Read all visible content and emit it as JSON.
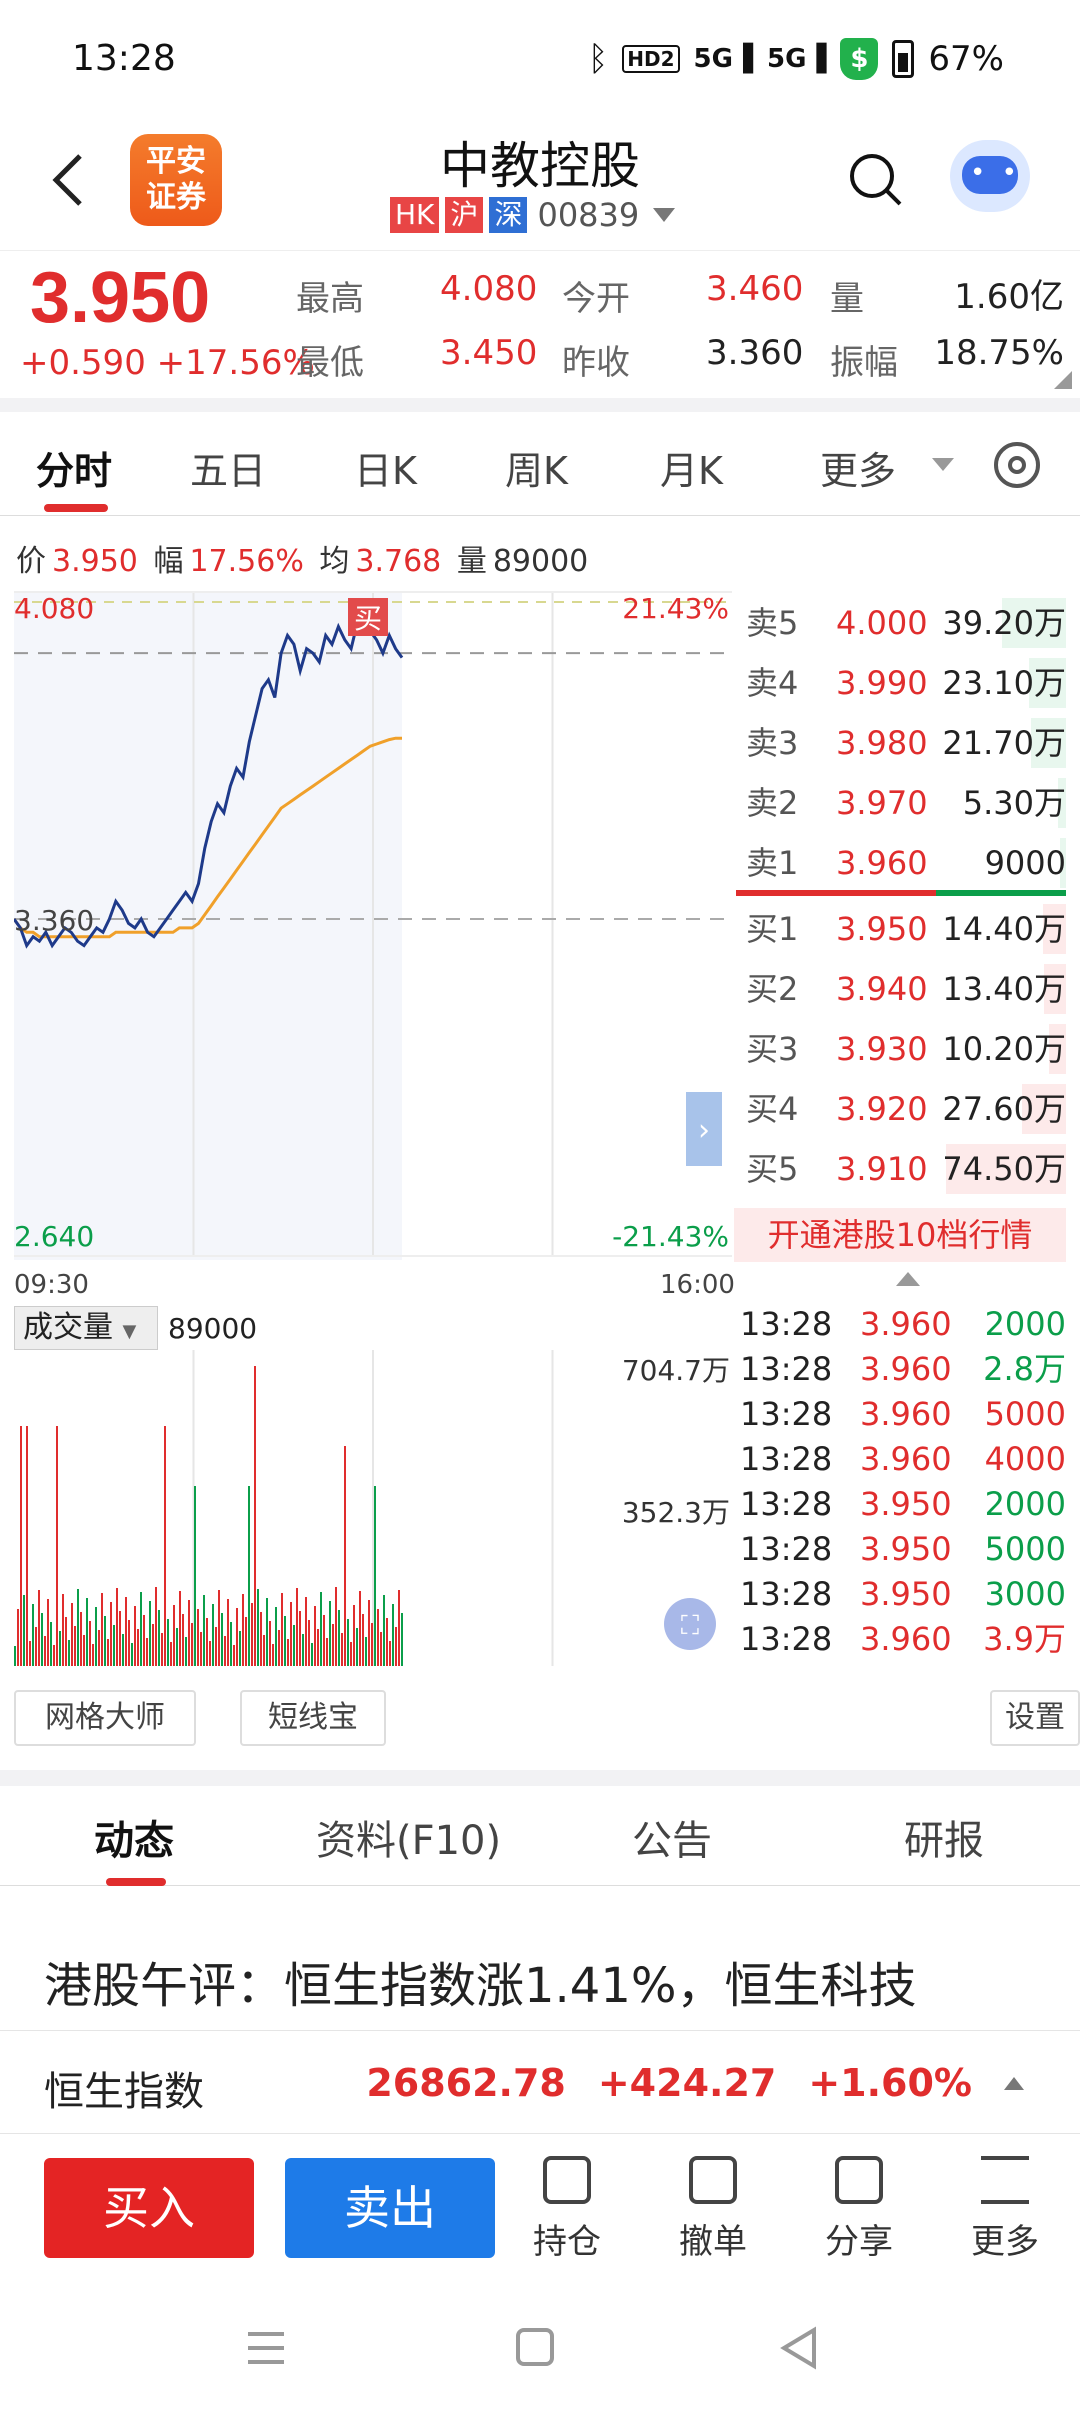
{
  "status_bar": {
    "time": "13:28",
    "hd_label": "HD2",
    "signal1": "5G",
    "signal2": "5G",
    "battery": "67%"
  },
  "header": {
    "logo_text_1": "平安",
    "logo_text_2": "证券",
    "title": "中教控股",
    "tags": [
      "HK",
      "沪",
      "深"
    ],
    "code": "00839"
  },
  "quote": {
    "price": "3.950",
    "change": "+0.590",
    "change_pct": "+17.56%",
    "high_label": "最高",
    "high": "4.080",
    "low_label": "最低",
    "low": "3.450",
    "open_label": "今开",
    "open": "3.460",
    "prev_label": "昨收",
    "prev": "3.360",
    "vol_label": "量",
    "vol": "1.60亿",
    "amp_label": "振幅",
    "amp": "18.75%"
  },
  "tabs": [
    "分时",
    "五日",
    "日K",
    "周K",
    "月K",
    "更多"
  ],
  "info_line": {
    "price_label": "价",
    "price": "3.950",
    "pct_label": "幅",
    "pct": "17.56%",
    "avg_label": "均",
    "avg": "3.768",
    "vol_label": "量",
    "vol": "89000"
  },
  "chart_data": {
    "type": "line",
    "y_max_label": "4.080",
    "y_mid_label": "3.360",
    "y_min_label": "2.640",
    "pct_max_label": "21.43%",
    "pct_min_label": "-21.43%",
    "x_start": "09:30",
    "x_end": "16:00",
    "ylim": [
      2.64,
      4.08
    ],
    "prev_close": 3.36,
    "buy_marker": "买",
    "price_series": [
      3.36,
      3.34,
      3.3,
      3.32,
      3.31,
      3.33,
      3.3,
      3.32,
      3.34,
      3.33,
      3.31,
      3.3,
      3.32,
      3.34,
      3.33,
      3.36,
      3.4,
      3.38,
      3.35,
      3.34,
      3.36,
      3.33,
      3.32,
      3.34,
      3.36,
      3.38,
      3.4,
      3.42,
      3.4,
      3.44,
      3.52,
      3.58,
      3.62,
      3.6,
      3.66,
      3.7,
      3.68,
      3.76,
      3.82,
      3.88,
      3.9,
      3.86,
      3.96,
      4.0,
      3.98,
      3.92,
      3.97,
      3.96,
      3.94,
      4.0,
      3.98,
      4.02,
      3.99,
      3.97,
      4.03,
      4.08,
      4.01,
      3.99,
      3.96,
      4.0,
      3.97,
      3.95
    ],
    "avg_series": [
      3.36,
      3.34,
      3.33,
      3.33,
      3.32,
      3.32,
      3.32,
      3.32,
      3.32,
      3.32,
      3.32,
      3.32,
      3.32,
      3.32,
      3.32,
      3.32,
      3.33,
      3.33,
      3.33,
      3.33,
      3.33,
      3.33,
      3.33,
      3.33,
      3.33,
      3.33,
      3.34,
      3.34,
      3.34,
      3.35,
      3.37,
      3.39,
      3.41,
      3.43,
      3.45,
      3.47,
      3.49,
      3.51,
      3.53,
      3.55,
      3.57,
      3.59,
      3.61,
      3.62,
      3.63,
      3.64,
      3.65,
      3.66,
      3.67,
      3.68,
      3.69,
      3.7,
      3.71,
      3.72,
      3.73,
      3.74,
      3.75,
      3.755,
      3.76,
      3.765,
      3.768,
      3.768
    ],
    "volume_label": "成交量",
    "volume_value": "89000",
    "volume_ticks": [
      "704.7万",
      "352.3万"
    ]
  },
  "order_book": {
    "asks": [
      {
        "label": "卖5",
        "price": "4.000",
        "vol": "39.20万",
        "ratio": 0.53
      },
      {
        "label": "卖4",
        "price": "3.990",
        "vol": "23.10万",
        "ratio": 0.31
      },
      {
        "label": "卖3",
        "price": "3.980",
        "vol": "21.70万",
        "ratio": 0.29
      },
      {
        "label": "卖2",
        "price": "3.970",
        "vol": "5.30万",
        "ratio": 0.07
      },
      {
        "label": "卖1",
        "price": "3.960",
        "vol": "9000",
        "ratio": 0.01
      }
    ],
    "bids": [
      {
        "label": "买1",
        "price": "3.950",
        "vol": "14.40万",
        "ratio": 0.19
      },
      {
        "label": "买2",
        "price": "3.940",
        "vol": "13.40万",
        "ratio": 0.18
      },
      {
        "label": "买3",
        "price": "3.930",
        "vol": "10.20万",
        "ratio": 0.14
      },
      {
        "label": "买4",
        "price": "3.920",
        "vol": "27.60万",
        "ratio": 0.37
      },
      {
        "label": "买5",
        "price": "3.910",
        "vol": "74.50万",
        "ratio": 1.0
      }
    ],
    "open_level10": "开通港股10档行情"
  },
  "trades": [
    {
      "time": "13:28",
      "price": "3.960",
      "vol": "2000",
      "side": "g"
    },
    {
      "time": "13:28",
      "price": "3.960",
      "vol": "2.8万",
      "side": "g"
    },
    {
      "time": "13:28",
      "price": "3.960",
      "vol": "5000",
      "side": "r"
    },
    {
      "time": "13:28",
      "price": "3.960",
      "vol": "4000",
      "side": "r"
    },
    {
      "time": "13:28",
      "price": "3.950",
      "vol": "2000",
      "side": "g"
    },
    {
      "time": "13:28",
      "price": "3.950",
      "vol": "5000",
      "side": "g"
    },
    {
      "time": "13:28",
      "price": "3.950",
      "vol": "3000",
      "side": "g"
    },
    {
      "time": "13:28",
      "price": "3.960",
      "vol": "3.9万",
      "side": "r"
    }
  ],
  "tools": {
    "grid_master": "网格大师",
    "short_line": "短线宝",
    "settings": "设置"
  },
  "news_tabs": [
    "动态",
    "资料(F10)",
    "公告",
    "研报"
  ],
  "news_headline": "港股午评：恒生指数涨1.41%，恒生科技",
  "ticker": {
    "name": "恒生指数",
    "value": "26862.78",
    "change": "+424.27",
    "pct": "+1.60%"
  },
  "bottom_bar": {
    "buy": "买入",
    "sell": "卖出",
    "position": "持仓",
    "cancel": "撤单",
    "share": "分享",
    "more": "更多"
  }
}
